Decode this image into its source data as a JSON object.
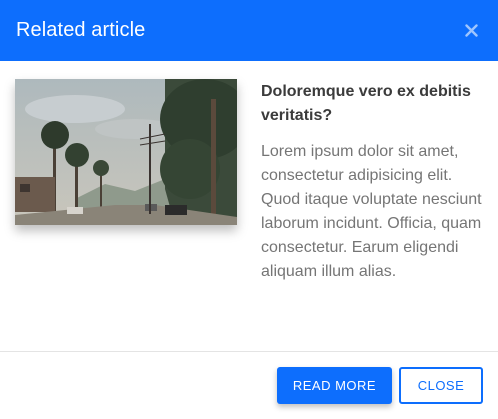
{
  "modal": {
    "title": "Related article",
    "close_icon": "close-icon",
    "image": {
      "alt": "Palm tree lined street"
    },
    "article": {
      "title": "Doloremque vero ex debitis veritatis?",
      "body": "Lorem ipsum dolor sit amet, consectetur adipisicing elit. Quod itaque voluptate nesciunt laborum incidunt. Officia, quam consectetur. Earum eligendi aliquam illum alias."
    },
    "buttons": {
      "read_more": "READ MORE",
      "close": "CLOSE"
    }
  },
  "colors": {
    "primary": "#0d6efd",
    "title_text": "#3b3b3b",
    "body_text": "#757575"
  }
}
